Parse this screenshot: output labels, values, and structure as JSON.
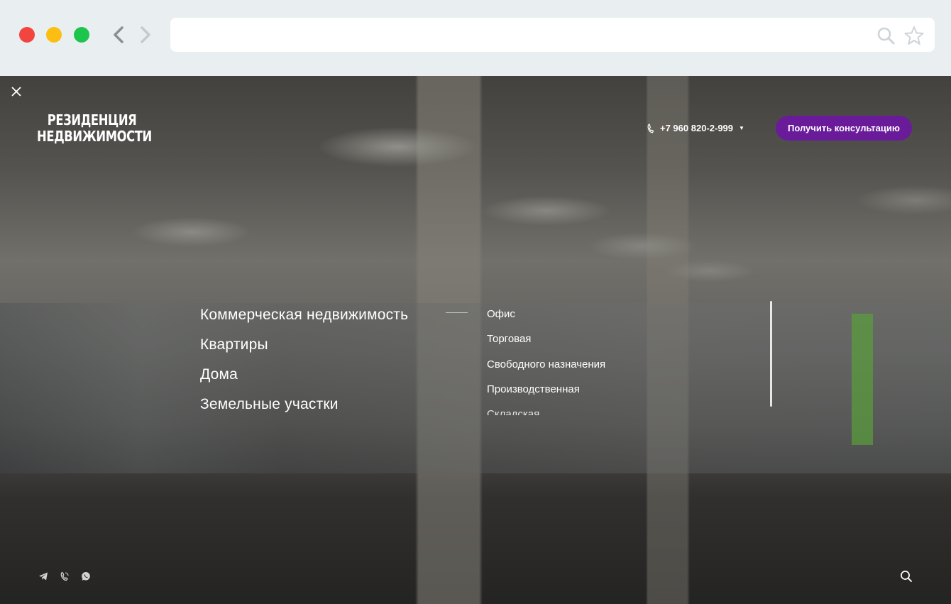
{
  "browser": {
    "url": "",
    "icons": [
      "back-arrow-icon",
      "forward-arrow-icon",
      "search-icon",
      "star-icon"
    ]
  },
  "site": {
    "logo_line1": "РЕЗИДЕНЦИЯ",
    "logo_line2": "НЕДВИЖИМОСТИ",
    "phone": "+7 960 820-2-999",
    "cta_label": "Получить консультацию",
    "accent_color": "#6a1b9a"
  },
  "menu": {
    "items": [
      {
        "label": "Коммерческая недвижимость"
      },
      {
        "label": "Квартиры"
      },
      {
        "label": "Дома"
      },
      {
        "label": "Земельные участки"
      }
    ],
    "submenu": [
      {
        "label": "Офис"
      },
      {
        "label": "Торговая"
      },
      {
        "label": "Свободного назначения"
      },
      {
        "label": "Производственная"
      },
      {
        "label": "Складская"
      }
    ]
  },
  "footer": {
    "socials": [
      "telegram-icon",
      "viber-icon",
      "whatsapp-icon"
    ],
    "search_icon": "search-icon"
  }
}
